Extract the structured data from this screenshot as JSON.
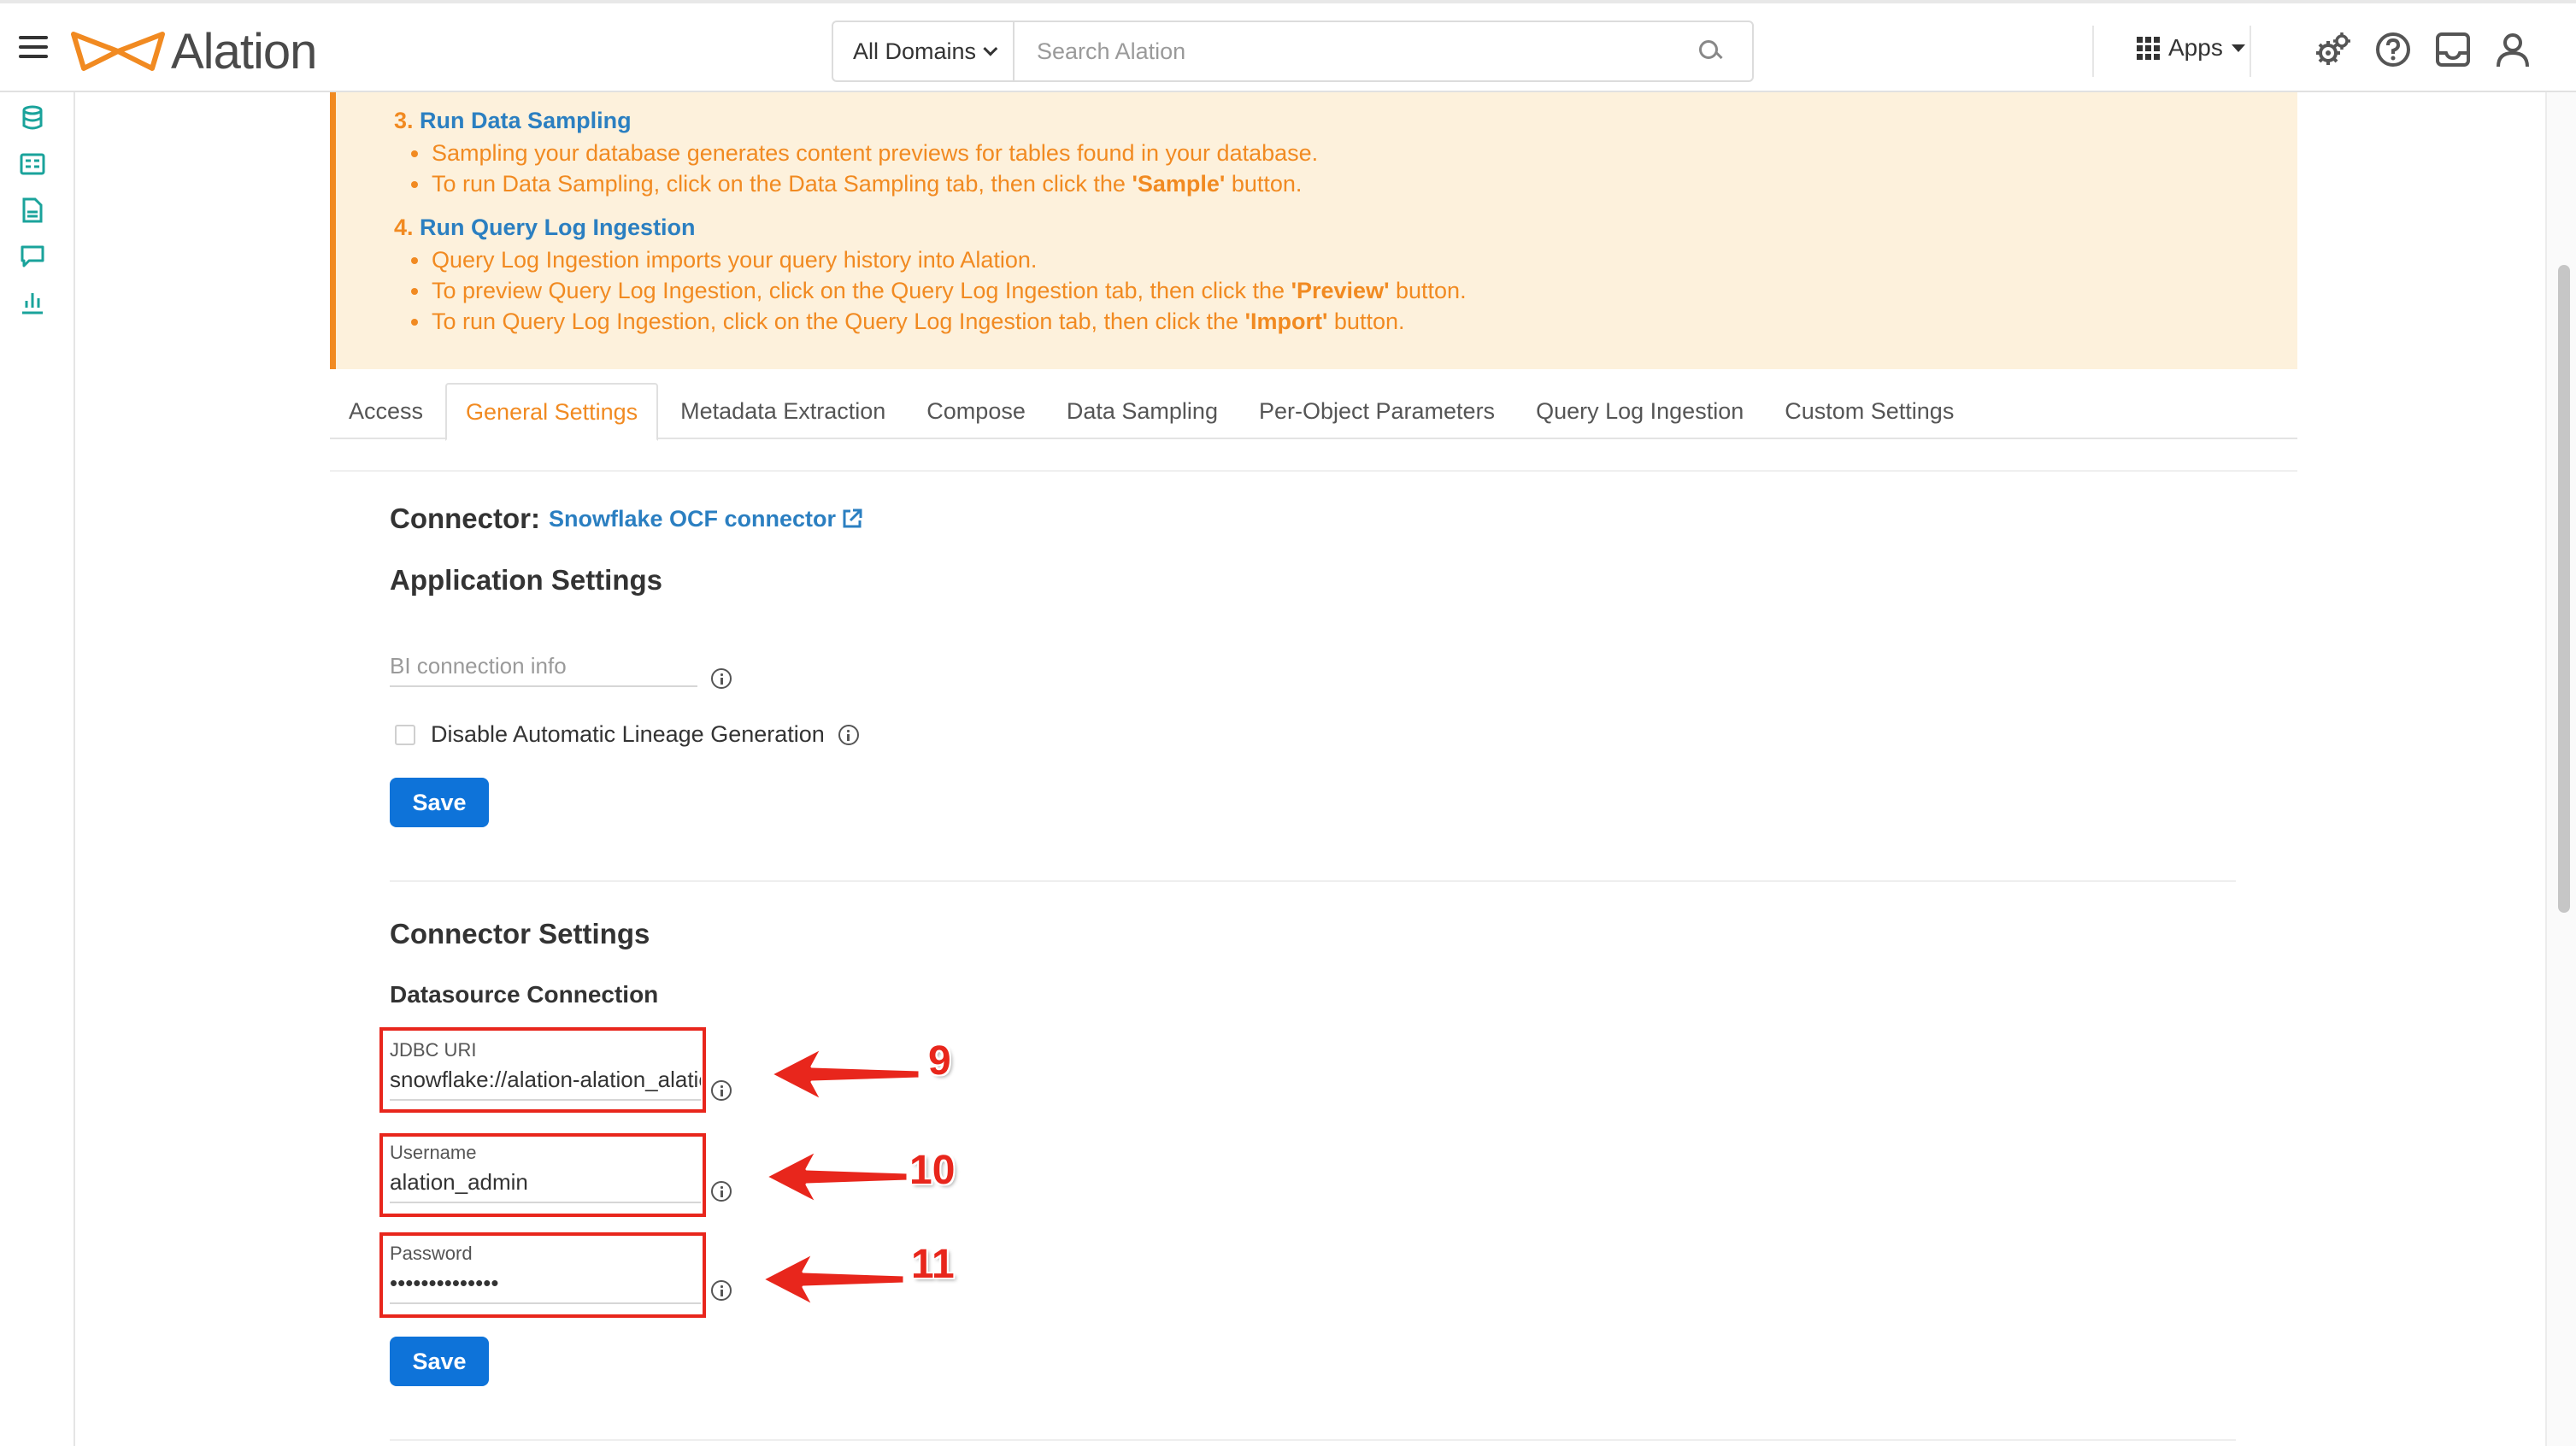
{
  "header": {
    "logo_text": "Alation",
    "domains_label": "All Domains",
    "search_placeholder": "Search Alation",
    "apps_label": "Apps"
  },
  "callout": {
    "steps": [
      {
        "number": "3.",
        "title": "Run Data Sampling",
        "items": [
          {
            "text": "Sampling your database generates content previews for tables found in your database."
          },
          {
            "pre": "To run Data Sampling, click on the Data Sampling tab, then click the ",
            "bold": "'Sample'",
            "post": " button."
          }
        ]
      },
      {
        "number": "4.",
        "title": "Run Query Log Ingestion",
        "items": [
          {
            "text": "Query Log Ingestion imports your query history into Alation."
          },
          {
            "pre": "To preview Query Log Ingestion, click on the Query Log Ingestion tab, then click the ",
            "bold": "'Preview'",
            "post": " button."
          },
          {
            "pre": "To run Query Log Ingestion, click on the Query Log Ingestion tab, then click the ",
            "bold": "'Import'",
            "post": " button."
          }
        ]
      }
    ]
  },
  "tabs": [
    {
      "label": "Access",
      "active": false
    },
    {
      "label": "General Settings",
      "active": true
    },
    {
      "label": "Metadata Extraction",
      "active": false
    },
    {
      "label": "Compose",
      "active": false
    },
    {
      "label": "Data Sampling",
      "active": false
    },
    {
      "label": "Per-Object Parameters",
      "active": false
    },
    {
      "label": "Query Log Ingestion",
      "active": false
    },
    {
      "label": "Custom Settings",
      "active": false
    }
  ],
  "content": {
    "connector_label": "Connector:",
    "connector_link": "Snowflake OCF connector",
    "app_settings_title": "Application Settings",
    "bi_placeholder": "BI connection info",
    "lineage_checkbox_label": "Disable Automatic Lineage Generation",
    "lineage_checked": false,
    "save_label": "Save",
    "connector_settings_title": "Connector Settings",
    "datasource_title": "Datasource Connection",
    "jdbc_label": "JDBC URI",
    "jdbc_value": "snowflake://alation-alation_alation",
    "username_label": "Username",
    "username_value": "alation_admin",
    "password_label": "Password",
    "password_value": "••••••••••••••",
    "save2_label": "Save"
  },
  "annotations": {
    "jdbc": "9",
    "username": "10",
    "password": "11"
  },
  "colors": {
    "accent_orange": "#f18a21",
    "link_blue": "#2b7fc1",
    "button_blue": "#0e73d9",
    "annotation_red": "#e8261c",
    "callout_bg": "#fdf1dc"
  }
}
